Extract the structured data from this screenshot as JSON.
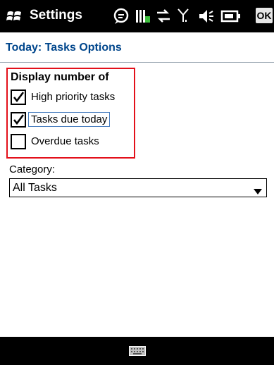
{
  "titlebar": {
    "title": "Settings",
    "ok_label": "OK",
    "icons": [
      "windows-start-icon",
      "notification-icon",
      "battery-signal-icon",
      "data-connection-icon",
      "signal-strength-icon",
      "volume-icon",
      "battery-icon"
    ]
  },
  "header": {
    "title": "Today: Tasks Options"
  },
  "display_group": {
    "heading": "Display number of",
    "options": [
      {
        "label": "High priority tasks",
        "checked": true
      },
      {
        "label": "Tasks due today",
        "checked": true
      },
      {
        "label": "Overdue tasks",
        "checked": false
      }
    ]
  },
  "category": {
    "label": "Category:",
    "selected": "All Tasks"
  },
  "bottombar": {
    "icon": "keyboard-icon"
  },
  "colors": {
    "highlight": "#e3101a",
    "header_text": "#00468c",
    "titlebar_bg": "#000000"
  }
}
